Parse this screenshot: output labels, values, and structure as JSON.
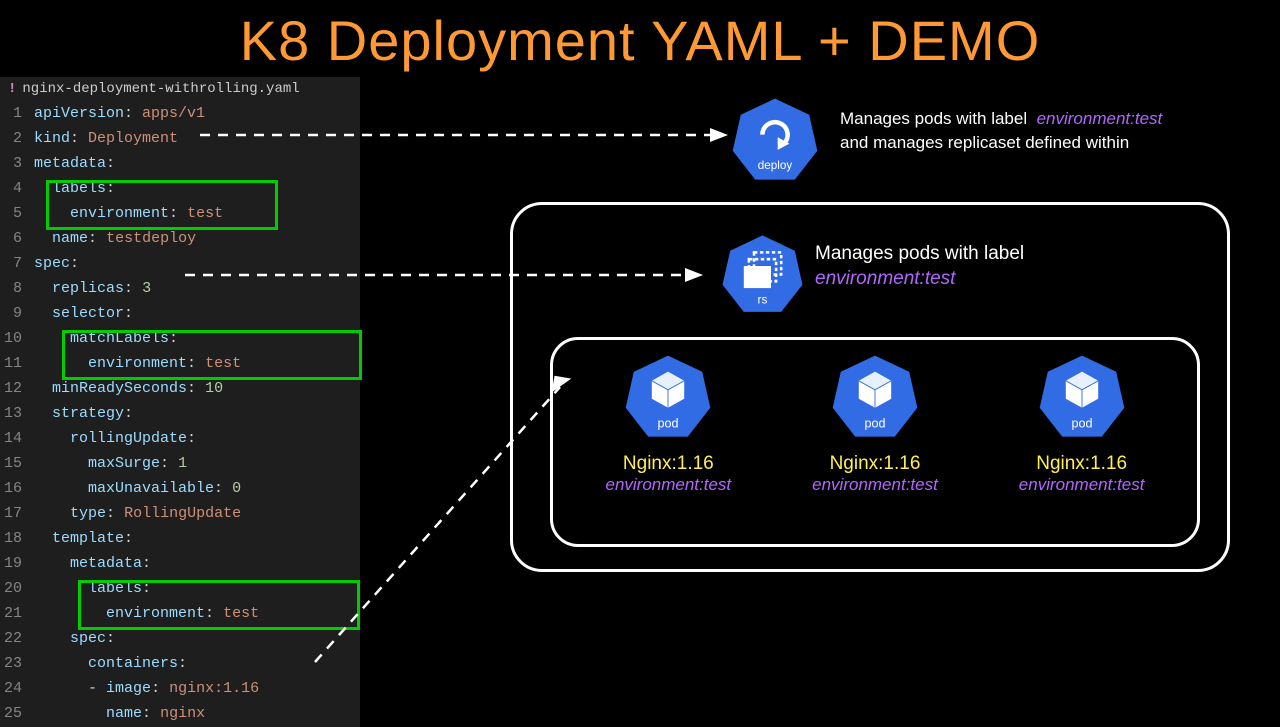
{
  "title": "K8 Deployment YAML + DEMO",
  "filename": "nginx-deployment-withrolling.yaml",
  "code_lines": [
    {
      "n": 1,
      "html": "<span class='k-key'>apiVersion</span><span class='k-punc'>:</span> <span class='k-val'>apps/v1</span>"
    },
    {
      "n": 2,
      "html": "<span class='k-key'>kind</span><span class='k-punc'>:</span> <span class='k-val'>Deployment</span>"
    },
    {
      "n": 3,
      "html": "<span class='k-key'>metadata</span><span class='k-punc'>:</span>"
    },
    {
      "n": 4,
      "html": "  <span class='k-key'>labels</span><span class='k-punc'>:</span>"
    },
    {
      "n": 5,
      "html": "    <span class='k-key'>environment</span><span class='k-punc'>:</span> <span class='k-val'>test</span>"
    },
    {
      "n": 6,
      "html": "  <span class='k-key'>name</span><span class='k-punc'>:</span> <span class='k-val'>testdeploy</span>"
    },
    {
      "n": 7,
      "html": "<span class='k-key'>spec</span><span class='k-punc'>:</span>"
    },
    {
      "n": 8,
      "html": "  <span class='k-key'>replicas</span><span class='k-punc'>:</span> <span class='k-num'>3</span>"
    },
    {
      "n": 9,
      "html": "  <span class='k-key'>selector</span><span class='k-punc'>:</span>"
    },
    {
      "n": 10,
      "html": "    <span class='k-key'>matchLabels</span><span class='k-punc'>:</span>"
    },
    {
      "n": 11,
      "html": "      <span class='k-key'>environment</span><span class='k-punc'>:</span> <span class='k-val'>test</span>"
    },
    {
      "n": 12,
      "html": "  <span class='k-key'>minReadySeconds</span><span class='k-punc'>:</span> <span class='k-num'>10</span>"
    },
    {
      "n": 13,
      "html": "  <span class='k-key'>strategy</span><span class='k-punc'>:</span>"
    },
    {
      "n": 14,
      "html": "    <span class='k-key'>rollingUpdate</span><span class='k-punc'>:</span>"
    },
    {
      "n": 15,
      "html": "      <span class='k-key'>maxSurge</span><span class='k-punc'>:</span> <span class='k-num'>1</span>"
    },
    {
      "n": 16,
      "html": "      <span class='k-key'>maxUnavailable</span><span class='k-punc'>:</span> <span class='k-num'>0</span>"
    },
    {
      "n": 17,
      "html": "    <span class='k-key'>type</span><span class='k-punc'>:</span> <span class='k-val'>RollingUpdate</span>"
    },
    {
      "n": 18,
      "html": "  <span class='k-key'>template</span><span class='k-punc'>:</span>"
    },
    {
      "n": 19,
      "html": "    <span class='k-key'>metadata</span><span class='k-punc'>:</span>"
    },
    {
      "n": 20,
      "html": "      <span class='k-key'>labels</span><span class='k-punc'>:</span>"
    },
    {
      "n": 21,
      "html": "        <span class='k-key'>environment</span><span class='k-punc'>:</span> <span class='k-val'>test</span>"
    },
    {
      "n": 22,
      "html": "    <span class='k-key'>spec</span><span class='k-punc'>:</span>"
    },
    {
      "n": 23,
      "html": "      <span class='k-key'>containers</span><span class='k-punc'>:</span>"
    },
    {
      "n": 24,
      "html": "      <span class='k-punc'>-</span> <span class='k-key'>image</span><span class='k-punc'>:</span> <span class='k-val'>nginx:1.16</span>"
    },
    {
      "n": 25,
      "html": "        <span class='k-key'>name</span><span class='k-punc'>:</span> <span class='k-val'>nginx</span>"
    }
  ],
  "deploy": {
    "label": "deploy",
    "desc_pre": "Manages pods with label",
    "desc_em": "environment:test",
    "desc_line2": "and manages replicaset defined within"
  },
  "replicaset": {
    "label": "rs",
    "desc_pre": "Manages pods with label",
    "desc_em": "environment:test"
  },
  "pods": [
    {
      "name": "Nginx:1.16",
      "env": "environment:test",
      "label": "pod"
    },
    {
      "name": "Nginx:1.16",
      "env": "environment:test",
      "label": "pod"
    },
    {
      "name": "Nginx:1.16",
      "env": "environment:test",
      "label": "pod"
    }
  ]
}
